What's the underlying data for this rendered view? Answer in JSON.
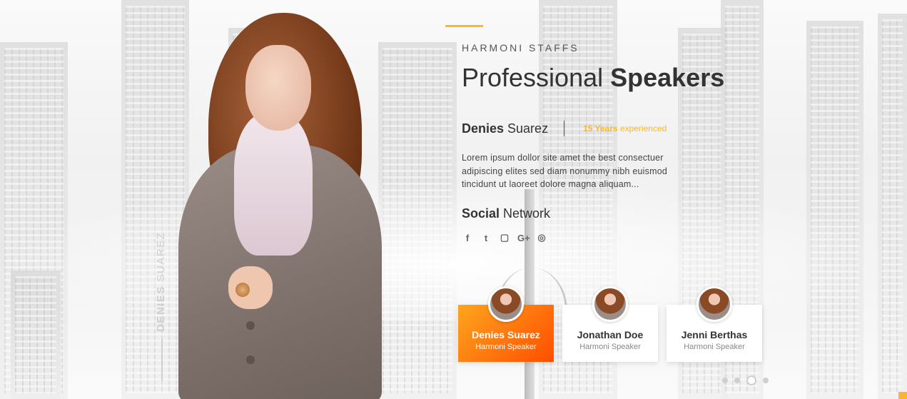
{
  "section": {
    "subtitle": "HARMONI STAFFS",
    "title_light": "Professional ",
    "title_bold": "Speakers",
    "accent_color": "#f7b733"
  },
  "featured": {
    "first_name": "Denies",
    "last_name": " Suarez",
    "experience_years": "15 Years",
    "experience_label": " experienced",
    "description": "Lorem ipsum dollor site amet the best consectuer adipiscing elites sed diam nonummy nibh euismod tincidunt ut laoreet dolore magna aliquam...",
    "vertical_first": "DENIES",
    "vertical_last": " SUAREZ"
  },
  "social": {
    "title_bold": "Social",
    "title_light": " Network",
    "icons": [
      {
        "name": "facebook-icon",
        "glyph": "f"
      },
      {
        "name": "twitter-icon",
        "glyph": "t"
      },
      {
        "name": "twitch-icon",
        "glyph": "▢"
      },
      {
        "name": "google-plus-icon",
        "glyph": "G+"
      },
      {
        "name": "instagram-icon",
        "glyph": "◎"
      }
    ]
  },
  "speakers": [
    {
      "name": "Denies Suarez",
      "role": "Harmoni Speaker",
      "active": true
    },
    {
      "name": "Jonathan Doe",
      "role": "Harmoni Speaker",
      "active": false
    },
    {
      "name": "Jenni Berthas",
      "role": "Harmoni Speaker",
      "active": false
    }
  ],
  "pagination": {
    "count": 4,
    "active_index": 2
  }
}
